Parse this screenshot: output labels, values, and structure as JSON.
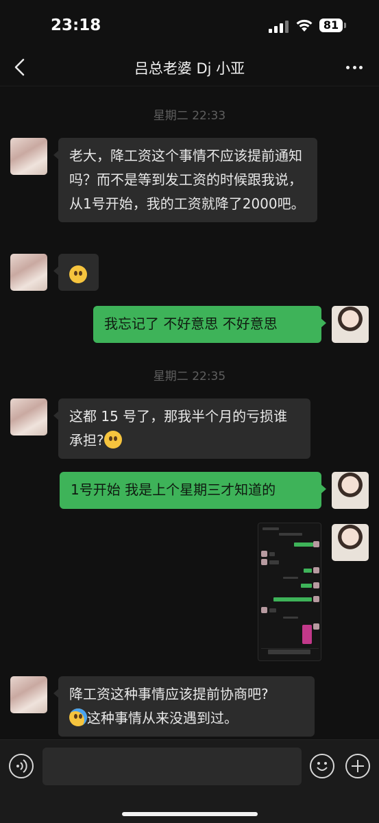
{
  "status_bar": {
    "time": "23:18",
    "battery": "81",
    "icons": [
      "signal-icon",
      "wifi-icon",
      "battery-icon"
    ]
  },
  "nav": {
    "back_icon": "chevron-left-icon",
    "title": "吕总老婆 Dj 小亚",
    "more_icon": "more-dots-icon"
  },
  "messages": {
    "ts1": "星期二 22:33",
    "m1": "老大，降工资这个事情不应该提前通知吗？而不是等到发工资的时候跟我说，从1号开始，我的工资就降了2000吧。",
    "m2_emoji": "zipper-mouth-face-icon",
    "m3": "我忘记了 不好意思 不好意思",
    "ts2": "星期二 22:35",
    "m4_text": "这都 15 号了，那我半个月的亏损谁承担?",
    "m4_emoji": "flushed-face-icon",
    "m5": "1号开始 我是上个星期三才知道的",
    "m6_image": "screenshot-thumbnail",
    "m7_line1": "降工资这种事情应该提前协商吧?",
    "m7_emoji": "crying-face-icon",
    "m7_line2": "这种事情从来没遇到过。"
  },
  "input_bar": {
    "voice_icon": "voice-icon",
    "placeholder": "",
    "emoji_icon": "emoji-icon",
    "plus_icon": "plus-icon"
  },
  "colors": {
    "background": "#111111",
    "incoming_bubble": "#2c2c2c",
    "outgoing_bubble": "#3eb359",
    "timestamp": "#5f5f5f"
  }
}
